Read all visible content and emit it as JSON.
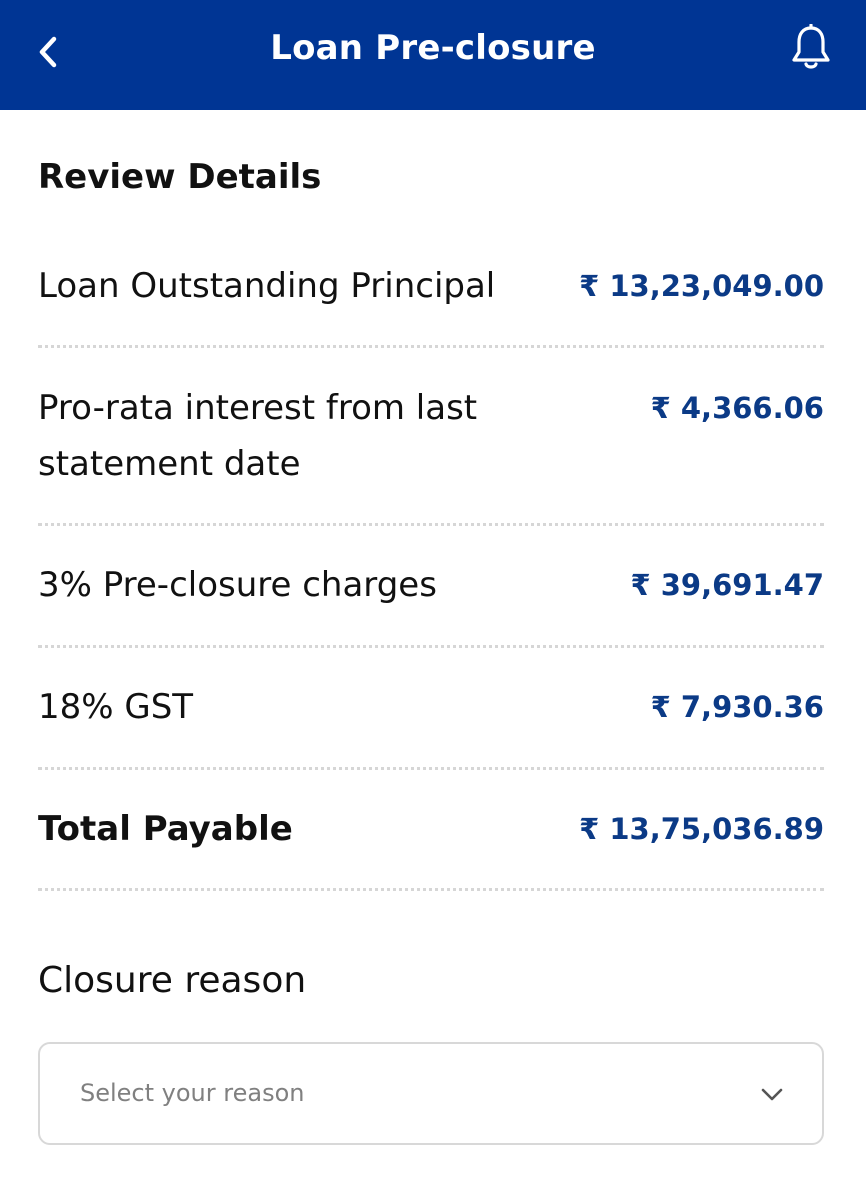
{
  "header": {
    "title": "Loan Pre-closure",
    "back_icon": "chevron-left-icon",
    "bell_icon": "bell-icon",
    "background_color": "#003594"
  },
  "review": {
    "title": "Review Details",
    "rows": [
      {
        "label": "Loan Outstanding Principal",
        "value": "₹ 13,23,049.00"
      },
      {
        "label": "Pro-rata interest from last statement date",
        "value": "₹ 4,366.06"
      },
      {
        "label": "3% Pre-closure charges",
        "value": "₹ 39,691.47"
      },
      {
        "label": "18% GST",
        "value": "₹ 7,930.36"
      },
      {
        "label": "Total Payable",
        "value": "₹ 13,75,036.89"
      }
    ],
    "value_color": "#0b3a86"
  },
  "closure": {
    "title": "Closure reason",
    "select_placeholder": "Select your reason",
    "select_icon": "chevron-down-icon"
  }
}
